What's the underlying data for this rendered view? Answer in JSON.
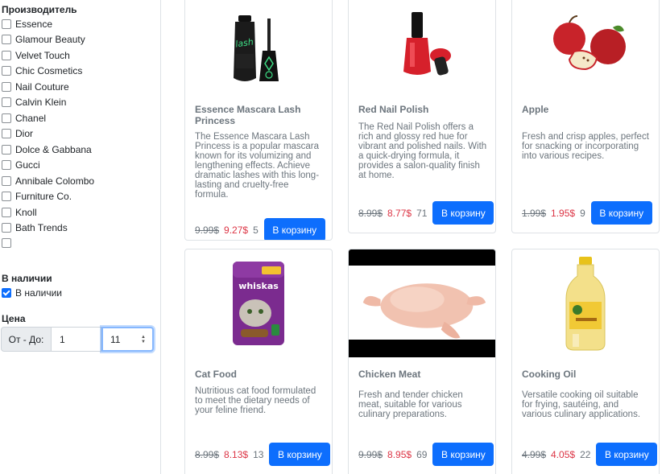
{
  "filters": {
    "manufacturer_title": "Производитель",
    "manufacturers": [
      "Essence",
      "Glamour Beauty",
      "Velvet Touch",
      "Chic Cosmetics",
      "Nail Couture",
      "Calvin Klein",
      "Chanel",
      "Dior",
      "Dolce & Gabbana",
      "Gucci",
      "Annibale Colombo",
      "Furniture Co.",
      "Knoll",
      "Bath Trends",
      ""
    ],
    "stock_title": "В наличии",
    "stock_label": "В наличии",
    "price_title": "Цена",
    "price_range_label": "От - До:",
    "price_from": "1",
    "price_to": "11"
  },
  "products": [
    {
      "title": "Essence Mascara Lash Princess",
      "desc": "The Essence Mascara Lash Princess is a popular mascara known for its volumizing and lengthening effects. Achieve dramatic lashes with this long-lasting and cruelty-free formula.",
      "old_price": "9.99$",
      "new_price": "9.27$",
      "stock": "5",
      "button": "В корзину"
    },
    {
      "title": "Red Nail Polish",
      "desc": "The Red Nail Polish offers a rich and glossy red hue for vibrant and polished nails. With a quick-drying formula, it provides a salon-quality finish at home.",
      "old_price": "8.99$",
      "new_price": "8.77$",
      "stock": "71",
      "button": "В корзину"
    },
    {
      "title": "Apple",
      "desc": "Fresh and crisp apples, perfect for snacking or incorporating into various recipes.",
      "old_price": "1.99$",
      "new_price": "1.95$",
      "stock": "9",
      "button": "В корзину"
    },
    {
      "title": "Cat Food",
      "desc": "Nutritious cat food formulated to meet the dietary needs of your feline friend.",
      "old_price": "8.99$",
      "new_price": "8.13$",
      "stock": "13",
      "button": "В корзину"
    },
    {
      "title": "Chicken Meat",
      "desc": "Fresh and tender chicken meat, suitable for various culinary preparations.",
      "old_price": "9.99$",
      "new_price": "8.95$",
      "stock": "69",
      "button": "В корзину"
    },
    {
      "title": "Cooking Oil",
      "desc": "Versatile cooking oil suitable for frying, sautéing, and various culinary applications.",
      "old_price": "4.99$",
      "new_price": "4.05$",
      "stock": "22",
      "button": "В корзину"
    }
  ],
  "packaging": {
    "mascara_brand": "lash",
    "cat_food_brand": "whiskas"
  },
  "colors": {
    "primary": "#0d6efd",
    "sale": "#dc3545",
    "muted": "#6c757d"
  }
}
